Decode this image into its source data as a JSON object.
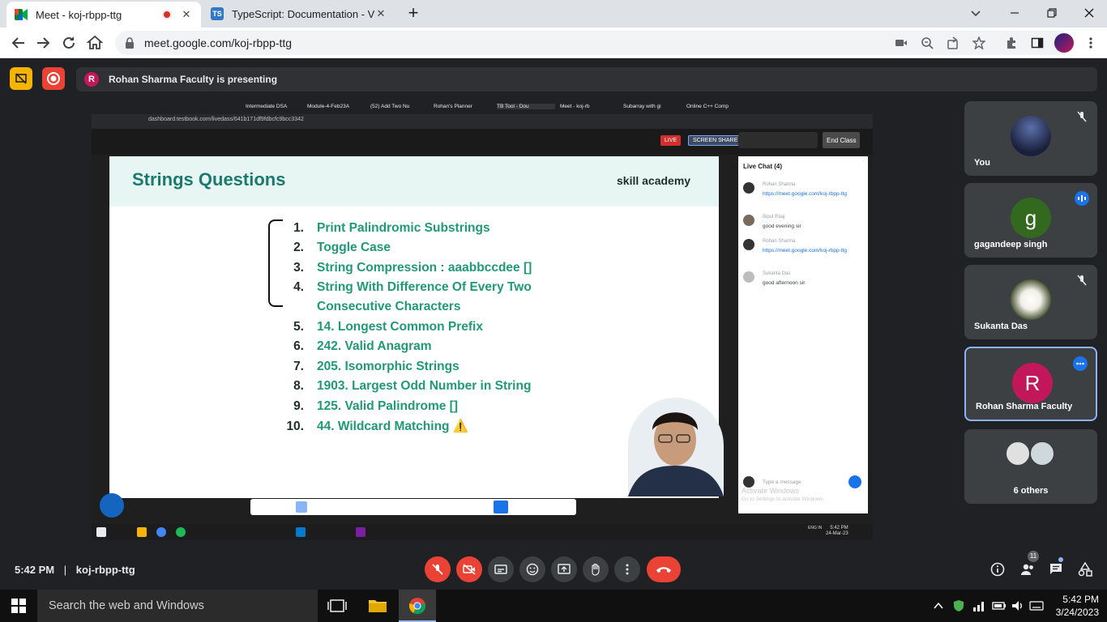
{
  "browser": {
    "tabs": [
      {
        "title": "Meet - koj-rbpp-ttg",
        "close": "✕"
      },
      {
        "title": "TypeScript: Documentation - Vari",
        "close": "✕"
      }
    ],
    "new_tab": "+",
    "url": "meet.google.com/koj-rbpp-ttg"
  },
  "meet": {
    "presenting_initial": "R",
    "presenting_text": "Rohan Sharma Faculty is presenting",
    "meeting_time": "5:42 PM",
    "separator": "|",
    "meeting_code": "koj-rbpp-ttg",
    "people_count": "11",
    "tiles": [
      {
        "name": "You"
      },
      {
        "name": "gagandeep singh",
        "initial": "g"
      },
      {
        "name": "Sukanta Das"
      },
      {
        "name": "Rohan Sharma Faculty",
        "initial": "R"
      },
      {
        "name": "6 others"
      }
    ]
  },
  "shared_screen": {
    "inner_url": "dashboard.testbook.com/livedass/641b171df9fdbcfc9bcc3342",
    "inner_tabs": [
      "Intermediate DSA",
      "Module-4-Feb23A",
      "(52) Add Two Nu",
      "Rohan's Planner",
      "TB Tool - Dou",
      "Meet - koj-rb",
      "Subarray with gi",
      "Online C++ Comp"
    ],
    "lms": {
      "live": "LIVE",
      "screen_share": "SCREEN SHARE",
      "end_class": "End Class"
    },
    "slide": {
      "title": "Strings Questions",
      "brand": "skill academy",
      "questions": [
        {
          "n": "1.",
          "text": "Print Palindromic Substrings"
        },
        {
          "n": "2.",
          "text": "Toggle Case"
        },
        {
          "n": "3.",
          "text": "String Compression : aaabbccdee []"
        },
        {
          "n": "4.",
          "text": "String With Difference Of Every Two"
        },
        {
          "n": "",
          "text": "Consecutive Characters"
        },
        {
          "n": "5.",
          "text": "14. Longest Common Prefix"
        },
        {
          "n": "6.",
          "text": "242. Valid Anagram"
        },
        {
          "n": "7.",
          "text": "205. Isomorphic Strings"
        },
        {
          "n": "8.",
          "text": "1903. Largest Odd Number in String"
        },
        {
          "n": "9.",
          "text": "125. Valid Palindrome []"
        },
        {
          "n": "10.",
          "text": "44. Wildcard Matching ⚠️"
        }
      ]
    },
    "chat": {
      "header": "Live Chat (4)",
      "messages": [
        {
          "name": "Rohan Sharma",
          "text": "https://meet.google.com/koj-rbpp-ttg",
          "link": true
        },
        {
          "name": "Bipul Raaj",
          "text": "good evening sir",
          "link": false
        },
        {
          "name": "Rohan Sharma",
          "text": "https://meet.google.com/koj-rbpp-ttg",
          "link": true
        },
        {
          "name": "Sukanta Das",
          "text": "good afternoon sir",
          "link": false
        }
      ],
      "input_placeholder": "Type a message",
      "watermark_1": "Activate Windows",
      "watermark_2": "Go to Settings to activate Windows."
    },
    "inner_clock": {
      "time": "5:42 PM",
      "date": "24-Mar-23",
      "lang": "ENG IN"
    }
  },
  "taskbar": {
    "search_placeholder": "Search the web and Windows",
    "time": "5:42 PM",
    "date": "3/24/2023"
  },
  "colors": {
    "meet_bg": "#202124",
    "end_call": "#ea4335",
    "slide_green": "#1f9a74",
    "accent_blue": "#1a73e8"
  }
}
